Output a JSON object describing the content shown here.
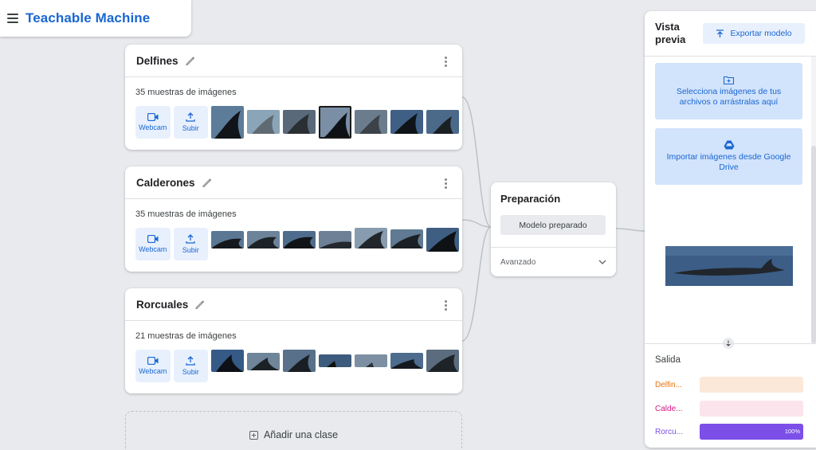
{
  "app": {
    "title": "Teachable Machine"
  },
  "classes": [
    {
      "name": "Delfines",
      "count": "35 muestras de imágenes",
      "webcam": "Webcam",
      "upload": "Subir"
    },
    {
      "name": "Calderones",
      "count": "35 muestras de imágenes",
      "webcam": "Webcam",
      "upload": "Subir"
    },
    {
      "name": "Rorcuales",
      "count": "21 muestras de imágenes",
      "webcam": "Webcam",
      "upload": "Subir"
    }
  ],
  "add_class": {
    "label": "Añadir una clase"
  },
  "training": {
    "title": "Preparación",
    "button": "Modelo preparado",
    "advanced": "Avanzado"
  },
  "preview": {
    "title": "Vista previa",
    "export": "Exportar modelo",
    "choose_files": "Selecciona imágenes de tus archivos o arrástralas aquí",
    "drive": "Importar imágenes desde Google Drive",
    "output_title": "Salida",
    "outputs": [
      {
        "label": "Delfin...",
        "value": 0,
        "color": "#e8710a",
        "bg": "#fce8d9",
        "pct": ""
      },
      {
        "label": "Calde...",
        "value": 0,
        "color": "#d01884",
        "bg": "#fce4ec",
        "pct": ""
      },
      {
        "label": "Rorcu...",
        "value": 100,
        "color": "#7b4fe8",
        "bg": "#7b4fe8",
        "pct": "100%"
      }
    ]
  }
}
